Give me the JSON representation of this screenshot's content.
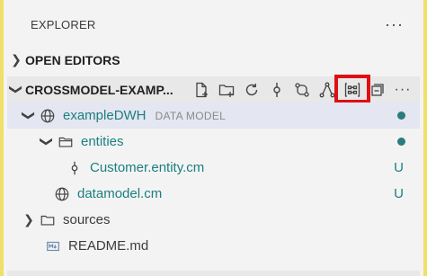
{
  "explorer": {
    "title": "EXPLORER",
    "more": "···"
  },
  "open_editors": {
    "label": "OPEN EDITORS"
  },
  "workspace": {
    "label": "CROSSMODEL-EXAMP...",
    "more": "···"
  },
  "tree": {
    "model": {
      "label": "exampleDWH",
      "description": "DATA MODEL"
    },
    "entities": {
      "label": "entities"
    },
    "customer": {
      "label": "Customer.entity.cm",
      "status": "U"
    },
    "datamodel": {
      "label": "datamodel.cm",
      "status": "U"
    },
    "sources": {
      "label": "sources"
    },
    "readme": {
      "label": "README.md"
    }
  },
  "colors": {
    "accent": "#1b7f7f",
    "highlight": "#e00f14",
    "border": "#f0e068"
  }
}
